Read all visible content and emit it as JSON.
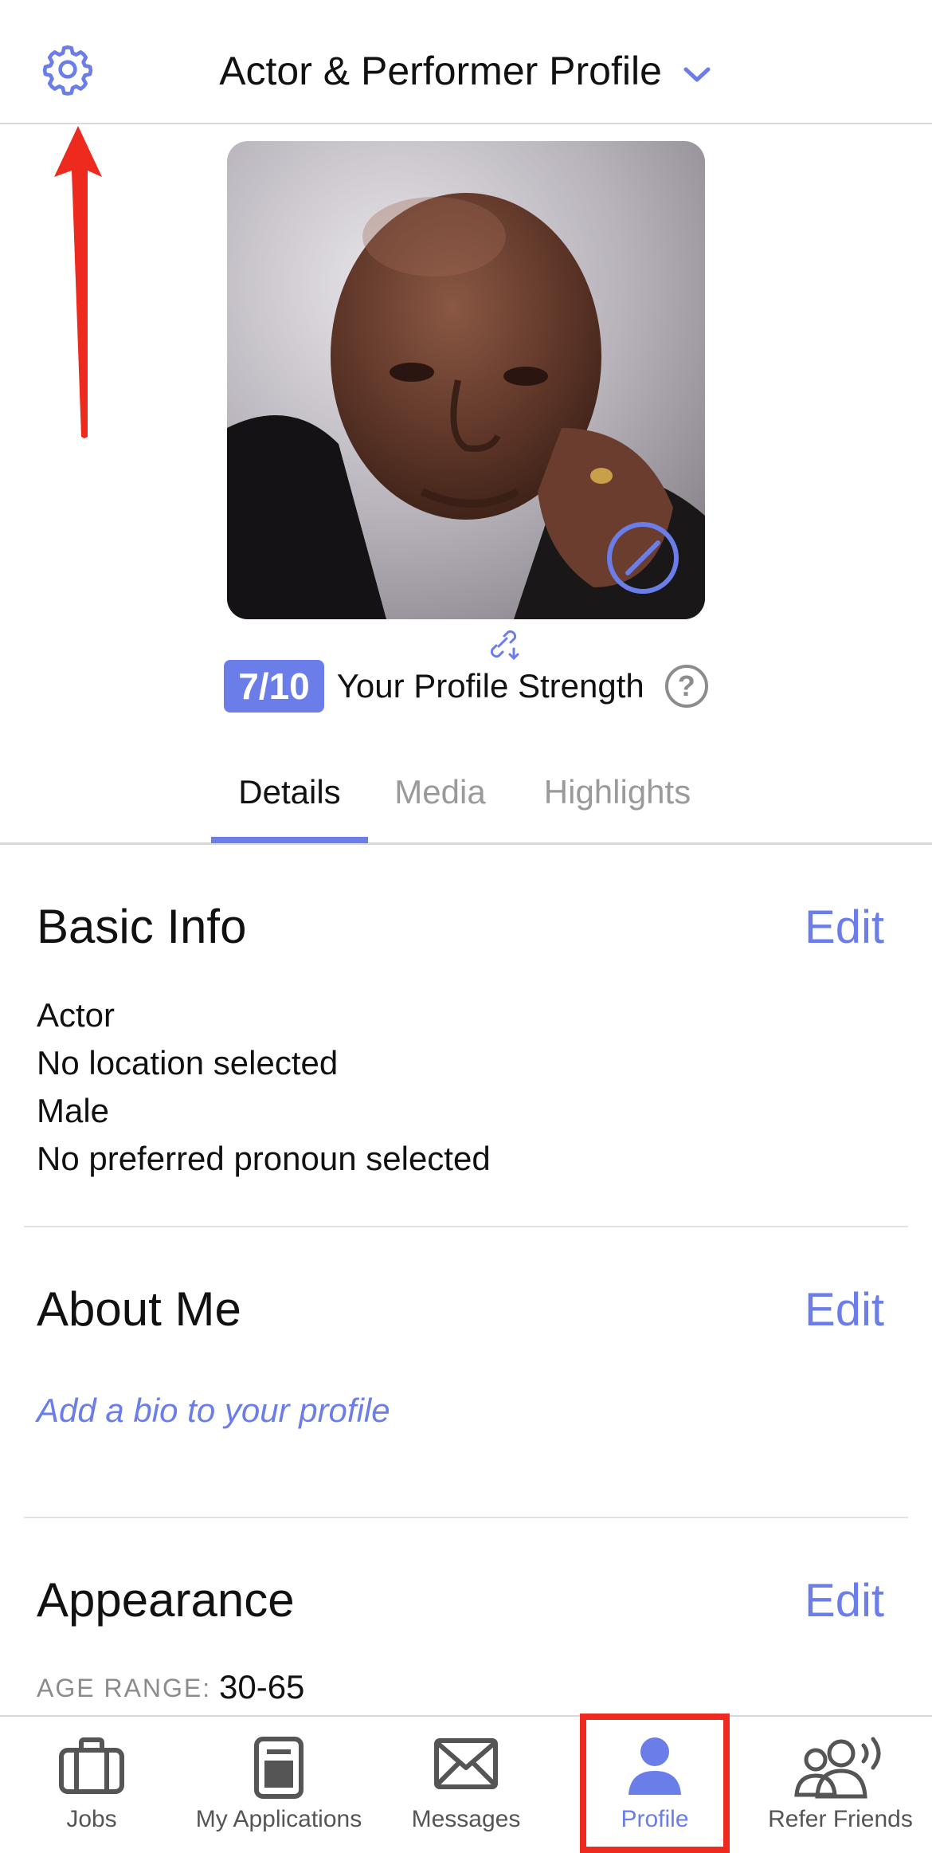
{
  "header": {
    "title": "Actor & Performer Profile",
    "icons": {
      "settings": "gear-icon",
      "dropdown": "chevron-down-icon"
    }
  },
  "profile": {
    "photo": "headshot-photo",
    "strength_score": "7/10",
    "strength_label": "Your Profile Strength",
    "help_label": "?"
  },
  "tabs": [
    {
      "label": "Details",
      "active": true
    },
    {
      "label": "Media",
      "active": false
    },
    {
      "label": "Highlights",
      "active": false
    }
  ],
  "basic_info": {
    "title": "Basic Info",
    "edit_label": "Edit",
    "lines": [
      "Actor",
      "No location selected",
      "Male",
      "No preferred pronoun selected"
    ]
  },
  "about_me": {
    "title": "About Me",
    "edit_label": "Edit",
    "placeholder": "Add a bio to your profile"
  },
  "appearance": {
    "title": "Appearance",
    "edit_label": "Edit",
    "age_range_label": "AGE RANGE:",
    "age_range_value": "30-65"
  },
  "tabbar": [
    {
      "label": "Jobs",
      "icon": "briefcase-icon",
      "active": false
    },
    {
      "label": "My Applications",
      "icon": "document-icon",
      "active": false
    },
    {
      "label": "Messages",
      "icon": "envelope-icon",
      "active": false
    },
    {
      "label": "Profile",
      "icon": "person-icon",
      "active": true
    },
    {
      "label": "Refer Friends",
      "icon": "refer-friends-icon",
      "active": false
    }
  ],
  "colors": {
    "accent": "#6b7de8",
    "annotation": "#ee2a1f",
    "text": "#111111",
    "muted": "#9a9a9a"
  }
}
